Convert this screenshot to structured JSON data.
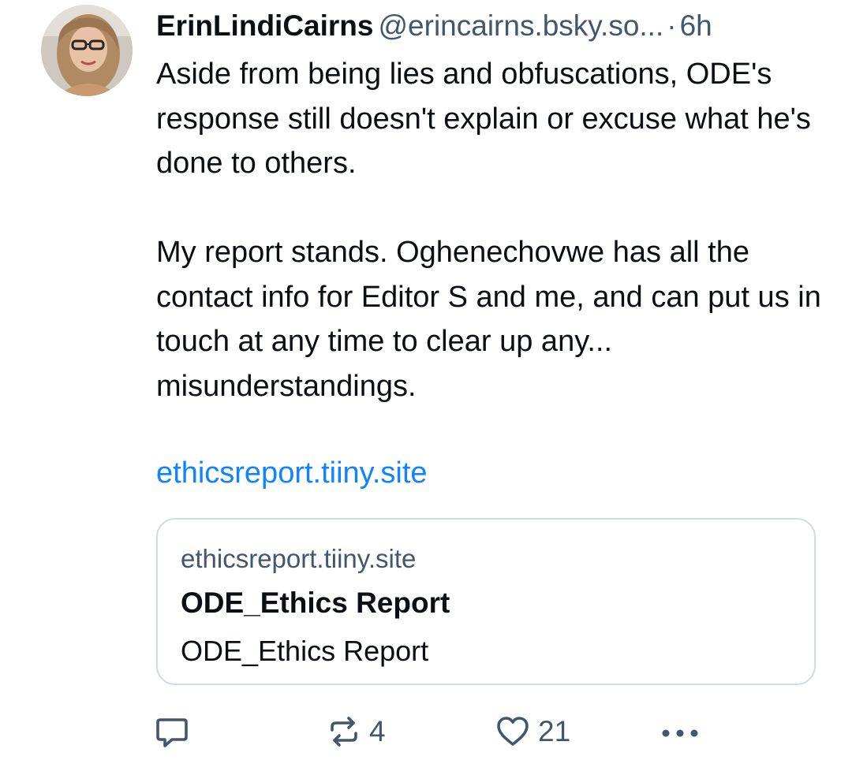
{
  "post": {
    "author": {
      "display_name": "ErinLindiCairns",
      "handle": "@erincairns.bsky.so...",
      "avatar_icon": "avatar-photo"
    },
    "separator": "·",
    "timestamp": "6h",
    "text_paragraphs": [
      "Aside from being lies and obfuscations, ODE's response still doesn't explain or excuse what he's done to others.",
      "My report stands. Oghenechovwe has all the contact info for Editor S and me, and can put us in touch at any time to clear up any... misunderstandings."
    ],
    "link": "ethicsreport.tiiny.site",
    "link_card": {
      "domain": "ethicsreport.tiiny.site",
      "title": "ODE_Ethics Report",
      "description": "ODE_Ethics Report"
    },
    "actions": {
      "reply": {
        "icon": "reply-icon",
        "count": ""
      },
      "repost": {
        "icon": "repost-icon",
        "count": "4"
      },
      "like": {
        "icon": "heart-icon",
        "count": "21"
      },
      "more": {
        "icon": "more-icon"
      }
    }
  },
  "colors": {
    "text": "#0b0f14",
    "muted": "#42576c",
    "link": "#1083fe",
    "border": "#d4dbe2"
  }
}
